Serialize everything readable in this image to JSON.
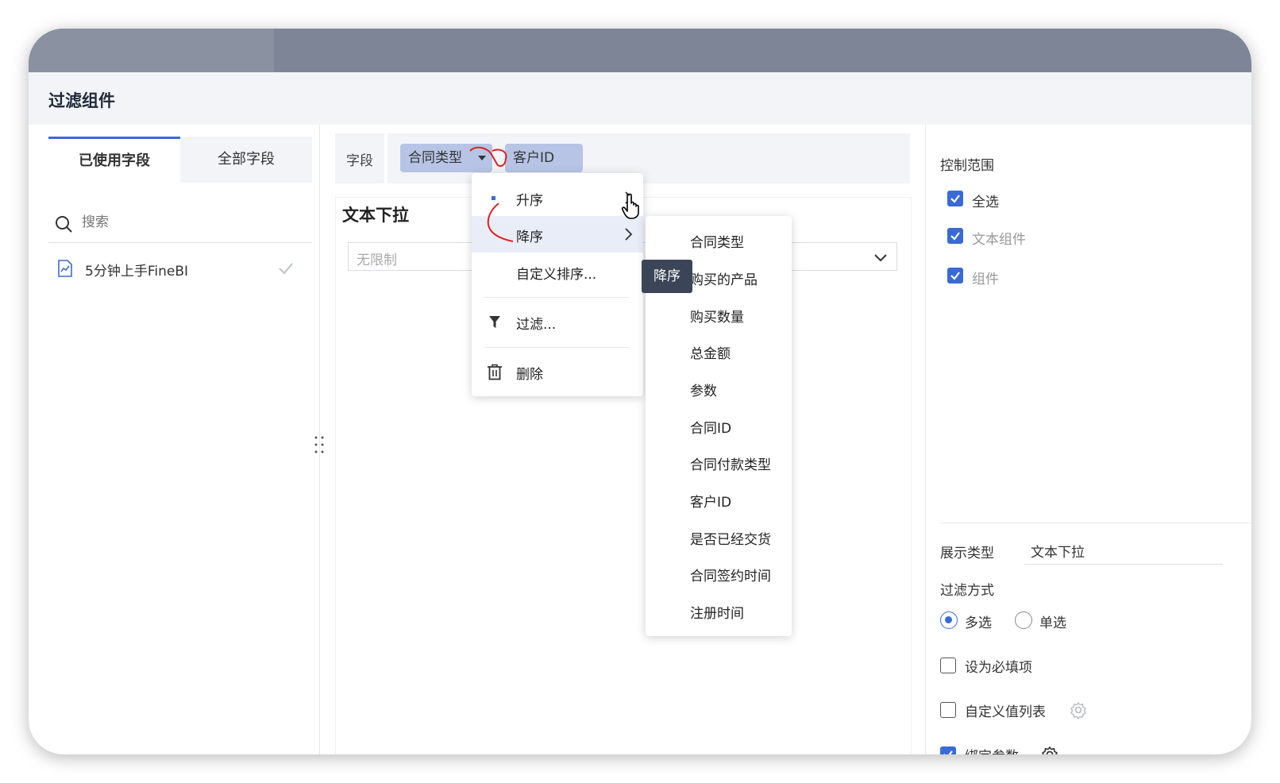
{
  "dialog": {
    "title": "过滤组件"
  },
  "left_panel": {
    "tabs": [
      {
        "label": "已使用字段",
        "active": true
      },
      {
        "label": "全部字段",
        "active": false
      }
    ],
    "search": {
      "placeholder": "搜索",
      "value": ""
    },
    "dataset": {
      "label": "5分钟上手FineBI",
      "icon": "chart-file-icon"
    }
  },
  "field_bar": {
    "label": "字段",
    "chips": [
      {
        "label": "合同类型",
        "has_dropdown": true
      },
      {
        "label": "客户ID",
        "has_dropdown": false
      }
    ]
  },
  "widget": {
    "title": "文本下拉",
    "select_placeholder": "无限制"
  },
  "context_menu": {
    "items": [
      {
        "label": "升序",
        "icon": "selected-dot-icon",
        "has_submenu": true
      },
      {
        "label": "降序",
        "icon": "",
        "has_submenu": true,
        "highlighted": true
      },
      {
        "label": "自定义排序...",
        "icon": ""
      },
      {
        "label": "过滤...",
        "icon": "filter-icon"
      },
      {
        "label": "删除",
        "icon": "trash-icon"
      }
    ]
  },
  "submenu": {
    "items": [
      "合同类型",
      "购买的产品",
      "购买数量",
      "总金额",
      "参数",
      "合同ID",
      "合同付款类型",
      "客户ID",
      "是否已经交货",
      "合同签约时间",
      "注册时间"
    ]
  },
  "tooltip": {
    "text": "降序"
  },
  "right_panel": {
    "control_scope": {
      "title": "控制范围",
      "items": [
        {
          "label": "全选",
          "checked": true
        },
        {
          "label": "文本组件",
          "checked": true
        },
        {
          "label": "组件",
          "checked": true
        }
      ]
    },
    "display_type": {
      "label": "展示类型",
      "value": "文本下拉"
    },
    "filter_mode": {
      "label": "过滤方式",
      "options": [
        {
          "label": "多选",
          "selected": true
        },
        {
          "label": "单选",
          "selected": false
        }
      ]
    },
    "options": [
      {
        "label": "设为必填项",
        "checked": false,
        "has_gear": false
      },
      {
        "label": "自定义值列表",
        "checked": false,
        "has_gear": true,
        "gear_active": false
      },
      {
        "label": "绑定参数",
        "checked": true,
        "has_gear": true,
        "gear_active": true
      }
    ]
  },
  "colors": {
    "accent": "#3a6ad6",
    "chip": "#b7c4e6",
    "tooltip_bg": "#3c4558",
    "annotation": "#e02020"
  }
}
